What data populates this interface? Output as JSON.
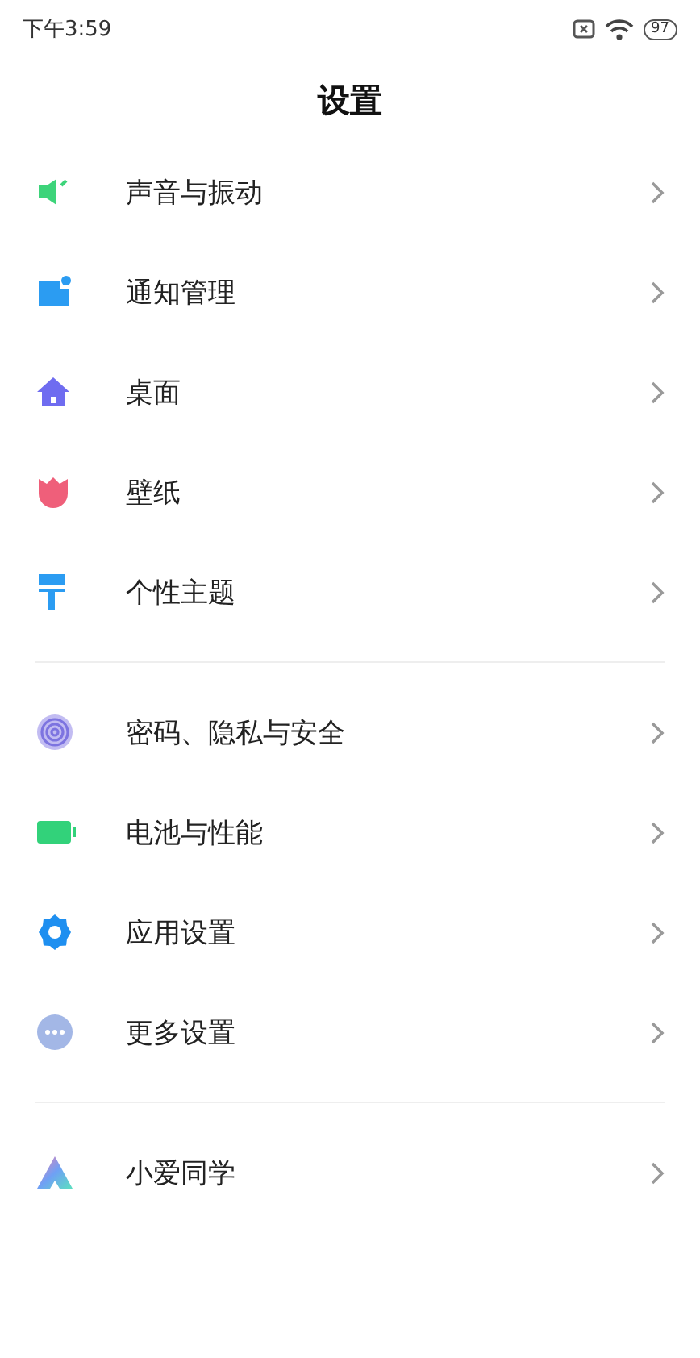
{
  "status_bar": {
    "time": "下午3:59",
    "battery": "97"
  },
  "title": "设置",
  "groups": [
    {
      "items": [
        {
          "label": "声音与振动"
        },
        {
          "label": "通知管理"
        },
        {
          "label": "桌面"
        },
        {
          "label": "壁纸"
        },
        {
          "label": "个性主题"
        }
      ]
    },
    {
      "items": [
        {
          "label": "密码、隐私与安全"
        },
        {
          "label": "电池与性能"
        },
        {
          "label": "应用设置"
        },
        {
          "label": "更多设置"
        }
      ]
    },
    {
      "items": [
        {
          "label": "小爱同学"
        }
      ]
    }
  ]
}
